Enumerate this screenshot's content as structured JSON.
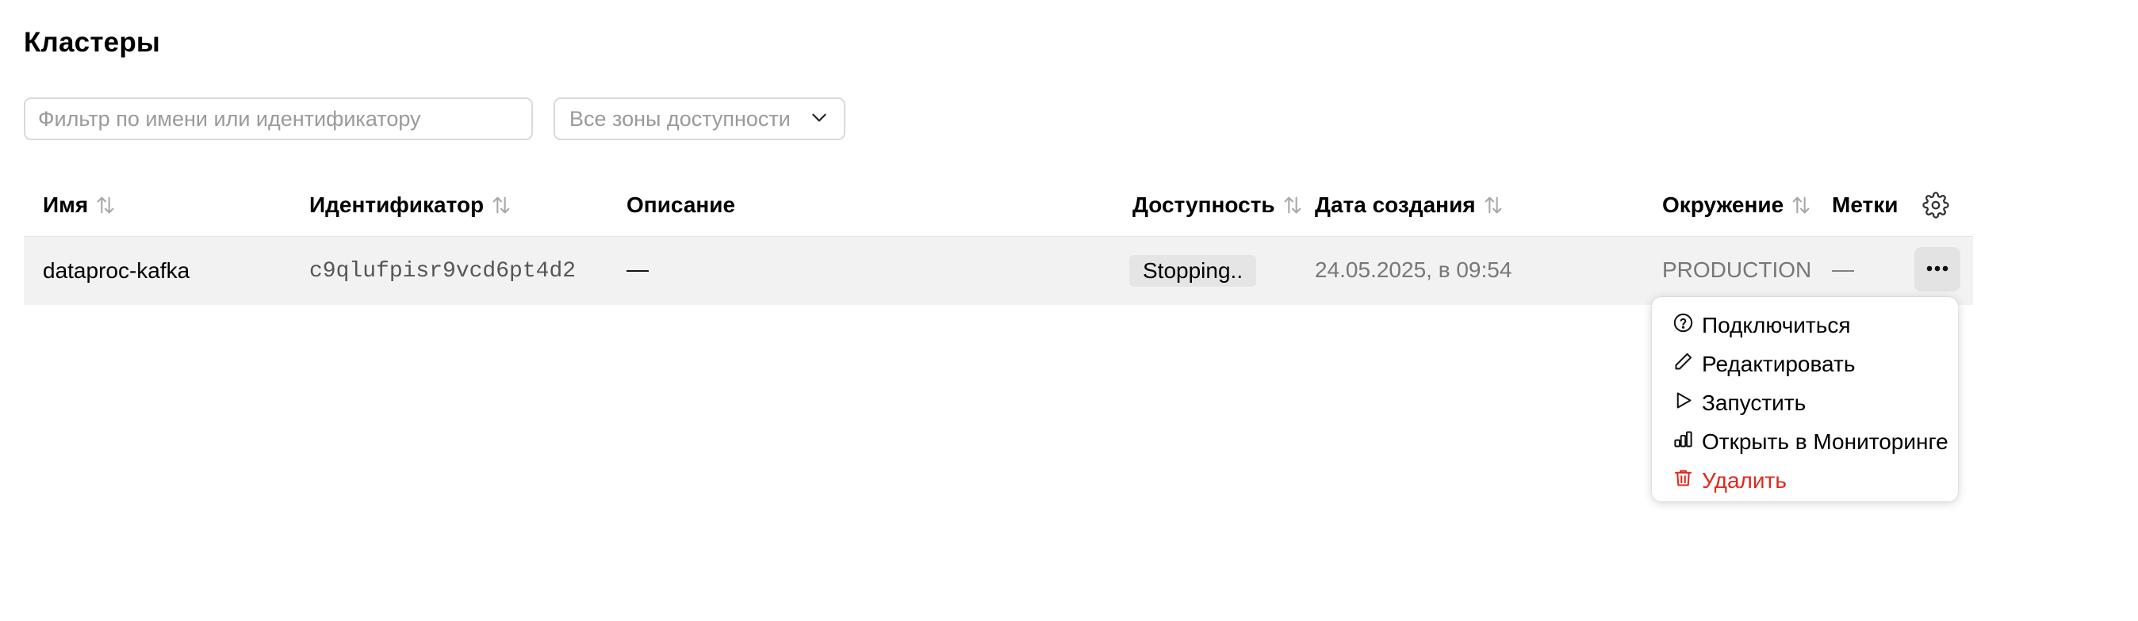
{
  "page": {
    "title": "Кластеры"
  },
  "filters": {
    "search_placeholder": "Фильтр по имени или идентификатору",
    "zone_placeholder": "Все зоны доступности"
  },
  "table": {
    "columns": {
      "name": "Имя",
      "id": "Идентификатор",
      "description": "Описание",
      "availability": "Доступность",
      "created": "Дата создания",
      "environment": "Окружение",
      "labels": "Метки"
    },
    "rows": [
      {
        "name": "dataproc-kafka",
        "id": "c9qlufpisr9vcd6pt4d2",
        "description": "—",
        "availability": "Stopping..",
        "created": "24.05.2025, в 09:54",
        "environment": "PRODUCTION",
        "labels": "—"
      }
    ]
  },
  "menu": {
    "items": [
      {
        "label": "Подключиться",
        "icon": "help-circle-icon"
      },
      {
        "label": "Редактировать",
        "icon": "pencil-icon"
      },
      {
        "label": "Запустить",
        "icon": "play-icon"
      },
      {
        "label": "Открыть в Мониторинге",
        "icon": "chart-bars-icon"
      },
      {
        "label": "Удалить",
        "icon": "trash-icon",
        "danger": true
      }
    ]
  },
  "colors": {
    "danger": "#e0281d",
    "row_bg": "#f2f2f2",
    "badge_bg": "#e5e5e5"
  }
}
